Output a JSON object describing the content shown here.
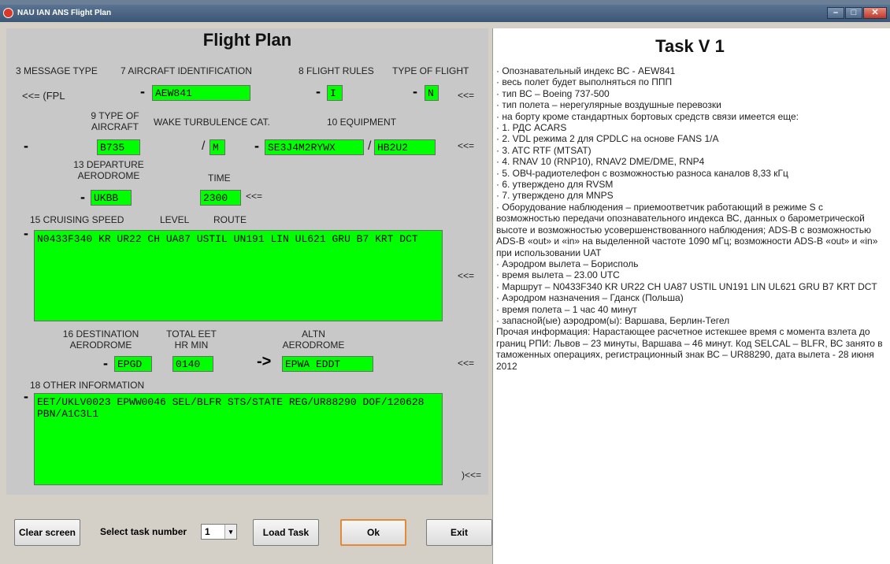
{
  "window": {
    "title": "NAU IAN ANS Flight Plan",
    "minimize": "–",
    "maximize": "□",
    "close": "✕"
  },
  "form": {
    "title": "Flight Plan",
    "labels": {
      "message_type": "3 MESSAGE TYPE",
      "aircraft_id": "7 AIRCRAFT IDENTIFICATION",
      "flight_rules": "8 FLIGHT RULES",
      "type_of_flight": "TYPE OF FLIGHT",
      "type_of_aircraft_1": "9 TYPE OF",
      "type_of_aircraft_2": "AIRCRAFT",
      "wake_turbulence": "WAKE TURBULENCE CAT.",
      "equipment": "10 EQUIPMENT",
      "departure_1": "13 DEPARTURE",
      "departure_2": "AERODROME",
      "time": "TIME",
      "cruising_speed": "15 CRUISING SPEED",
      "level": "LEVEL",
      "route": "ROUTE",
      "destination_1": "16 DESTINATION",
      "destination_2": "AERODROME",
      "total_eet_1": "TOTAL EET",
      "total_eet_2": "HR MIN",
      "altn_1": "ALTN",
      "altn_2": "AERODROME",
      "other_info": "18 OTHER INFORMATION"
    },
    "symbols": {
      "fpl_prefix": "<<= (FPL",
      "dash": "-",
      "slash": "/",
      "end_arrow": "<<=",
      "final_arrow": ")<<=",
      "altn_arrow": "->"
    },
    "values": {
      "aircraft_id": "AEW841",
      "flight_rules": "I",
      "type_of_flight": "N",
      "aircraft_type": "B735",
      "wake_turbulence": "M",
      "equipment": "SE3J4M2RYWX",
      "equipment_surveillance": "HB2U2",
      "departure": "UKBB",
      "time": "2300",
      "route": "N0433F340 KR UR22 CH UA87 USTIL UN191 LIN UL621 GRU B7 KRT DCT",
      "destination": "EPGD",
      "total_eet": "0140",
      "altn": "EPWA EDDT",
      "other_info": "EET/UKLV0023 EPWW0046 SEL/BLFR STS/STATE REG/UR88290 DOF/120628 PBN/A1C3L1"
    }
  },
  "controls": {
    "clear_screen": "Clear screen",
    "select_task_label": "Select task number",
    "task_number": "1",
    "load_task": "Load Task",
    "ok": "Ok",
    "exit": "Exit"
  },
  "task": {
    "title": "Task V 1",
    "lines": [
      "· Опознавательный индекс ВС - AEW841",
      "· весь полет будет выполняться по ППП",
      "· тип ВС – Boeing 737-500",
      "· тип полета – нерегулярные воздушные перевозки",
      "· на борту кроме стандартных бортовых средств связи имеется еще:",
      "· 1. РДС ACARS",
      "· 2. VDL режима 2 для CPDLC на основе FANS 1/A",
      "· 3. ATC RTF (MTSAT)",
      "· 4. RNAV 10 (RNP10), RNAV2 DME/DME, RNP4",
      "· 5. ОВЧ-радиотелефон с возможностью разноса каналов 8,33 кГц",
      "· 6. утверждено для RVSM",
      "· 7. утверждено для MNPS",
      "· Оборудование наблюдения – приемоответчик работающий в режиме S с возможностью передачи опознавательного индекса ВС, данных о барометрической высоте и возможностью усовершенствованного наблюдения; ADS-B с возможностью ADS-B «out» и «in» на выделенной частоте 1090 мГц; возможности ADS-B «out» и «in» при использовании UAT",
      "· Аэродром вылета – Борисполь",
      "· время вылета – 23.00 UTC",
      "· Маршрут – N0433F340 KR UR22 CH UA87 USTIL UN191 LIN UL621 GRU B7 KRT DCT",
      "· Аэродром назначения – Гданск (Польша)",
      "· время полета – 1 час 40 минут",
      "· запасной(ые) аэродром(ы): Варшава, Берлин-Тегел",
      "Прочая информация: Нарастающее расчетное истекшее время с момента взлета до границ РПИ: Львов – 23 минуты, Варшава – 46 минут. Код SELCAL – BLFR, ВС занято в таможенных операциях, регистрационный знак ВС – UR88290, дата вылета  - 28 июня 2012"
    ]
  }
}
